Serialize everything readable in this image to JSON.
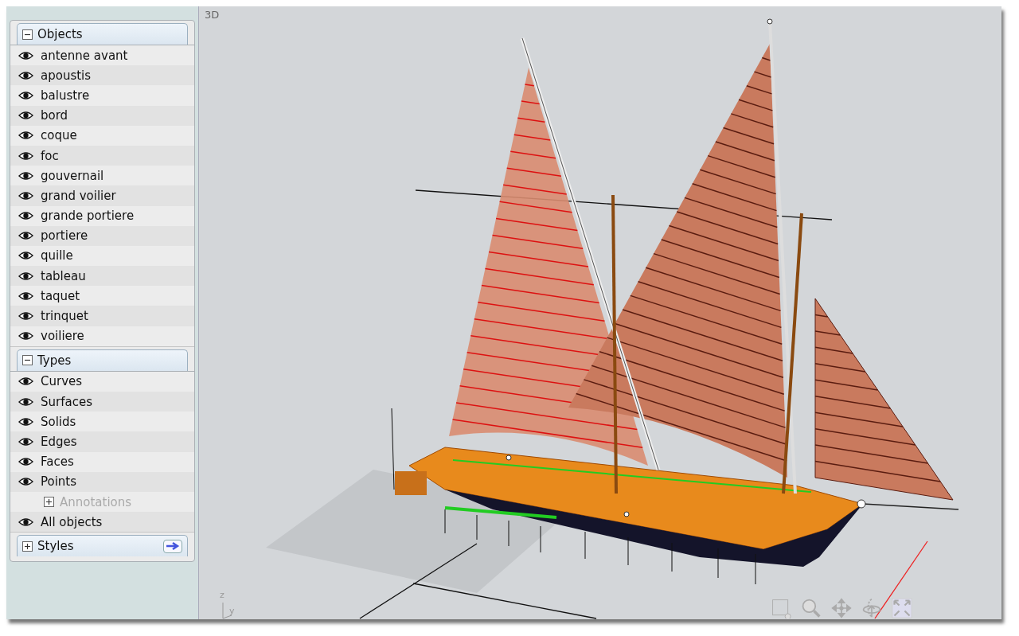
{
  "sidebar": {
    "sections": [
      {
        "title": "Objects",
        "expanded": true,
        "items": [
          {
            "kind": "layer",
            "label": "antenne avant",
            "visible": true
          },
          {
            "kind": "layer",
            "label": "apoustis",
            "visible": true
          },
          {
            "kind": "layer",
            "label": "balustre",
            "visible": true
          },
          {
            "kind": "layer",
            "label": "bord",
            "visible": true
          },
          {
            "kind": "layer",
            "label": "coque",
            "visible": true
          },
          {
            "kind": "layer",
            "label": "foc",
            "visible": true
          },
          {
            "kind": "layer",
            "label": "gouvernail",
            "visible": true
          },
          {
            "kind": "layer",
            "label": "grand voilier",
            "visible": true
          },
          {
            "kind": "layer",
            "label": "grande portiere",
            "visible": true
          },
          {
            "kind": "layer",
            "label": "portiere",
            "visible": true
          },
          {
            "kind": "layer",
            "label": "quille",
            "visible": true
          },
          {
            "kind": "layer",
            "label": "tableau",
            "visible": true
          },
          {
            "kind": "layer",
            "label": "taquet",
            "visible": true
          },
          {
            "kind": "layer",
            "label": "trinquet",
            "visible": true
          },
          {
            "kind": "layer",
            "label": "voiliere",
            "visible": true
          }
        ]
      },
      {
        "title": "Types",
        "expanded": true,
        "items": [
          {
            "kind": "layer",
            "label": "Curves",
            "visible": true
          },
          {
            "kind": "layer",
            "label": "Surfaces",
            "visible": true
          },
          {
            "kind": "layer",
            "label": "Solids",
            "visible": true
          },
          {
            "kind": "layer",
            "label": "Edges",
            "visible": true
          },
          {
            "kind": "layer",
            "label": "Faces",
            "visible": true
          },
          {
            "kind": "layer",
            "label": "Points",
            "visible": true
          },
          {
            "kind": "group",
            "label": "Annotations",
            "expanded": false,
            "disabled": true
          },
          {
            "kind": "layer",
            "label": "All objects",
            "visible": true
          }
        ]
      },
      {
        "title": "Styles",
        "expanded": false,
        "has_arrow": true
      }
    ]
  },
  "viewport": {
    "label": "3D",
    "axes": {
      "z": "z",
      "y": "y"
    }
  }
}
